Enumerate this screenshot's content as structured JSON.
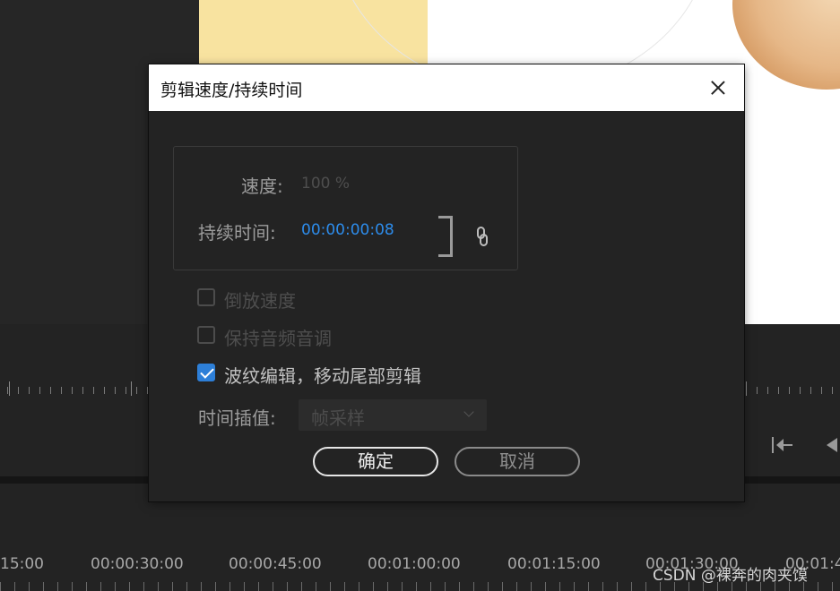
{
  "dialog": {
    "title": "剪辑速度/持续时间",
    "speed_label": "速度:",
    "speed_value": "100 %",
    "duration_label": "持续时间:",
    "duration_value": "00:00:00:08",
    "reverse_speed_label": "倒放速度",
    "reverse_speed_checked": false,
    "maintain_pitch_label": "保持音频音调",
    "maintain_pitch_checked": false,
    "ripple_edit_label": "波纹编辑，移动尾部剪辑",
    "ripple_edit_checked": true,
    "interpolation_label": "时间插值:",
    "interpolation_value": "帧采样",
    "ok_label": "确定",
    "cancel_label": "取消"
  },
  "timeline": {
    "labels": [
      "15:00",
      "00:00:30:00",
      "00:00:45:00",
      "00:01:00:00",
      "00:01:15:00",
      "00:01:30:00",
      "00:01:4"
    ]
  },
  "watermark": "CSDN @裸奔的肉夹馍",
  "colors": {
    "accent_blue": "#2d8ceb",
    "checkbox_blue": "#2d7fd8",
    "dialog_bg": "#232323"
  }
}
